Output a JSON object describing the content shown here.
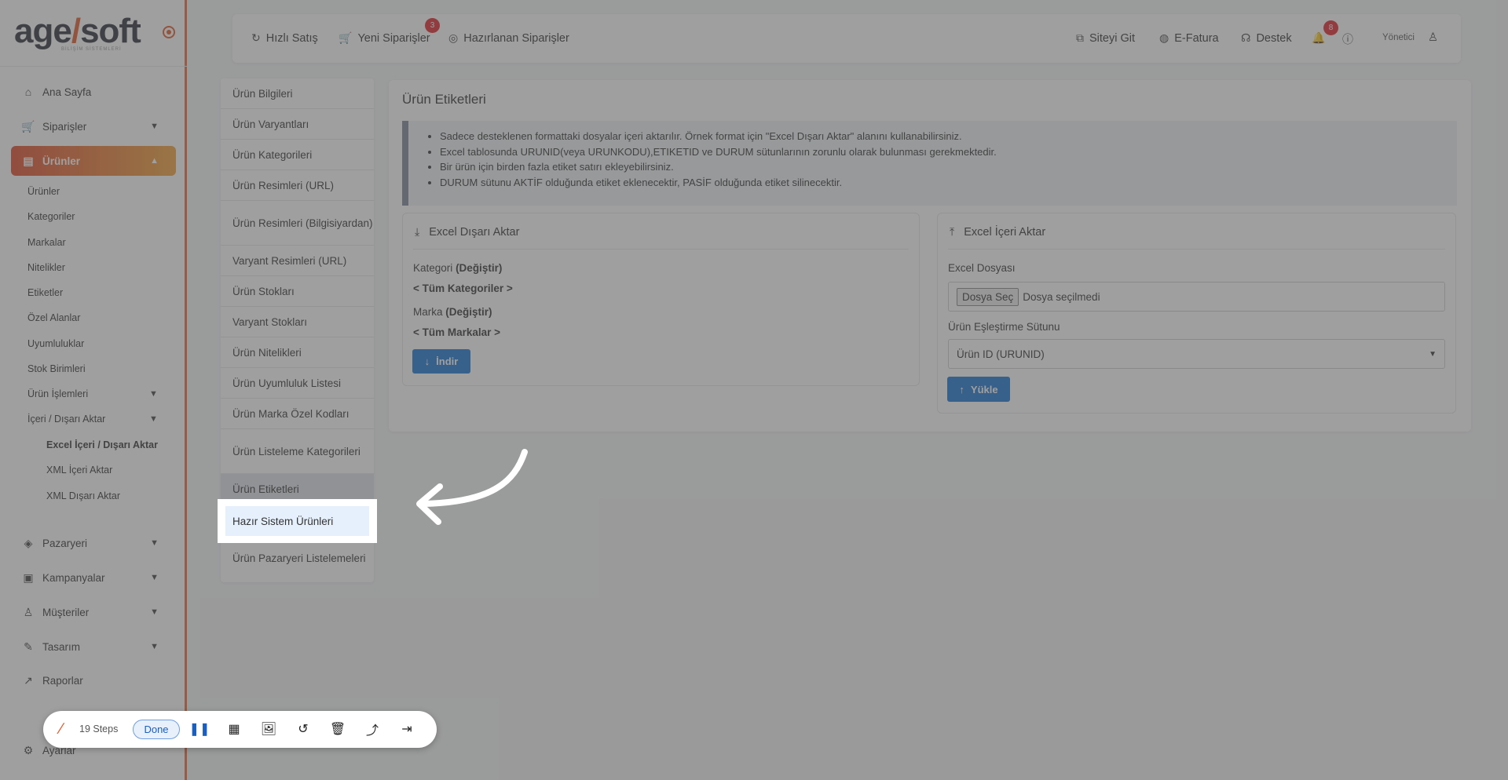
{
  "brand": {
    "logo_main": "age",
    "logo_slash": "/",
    "logo_tail": "soft",
    "logo_sub": "BİLİŞİM SİSTEMLERİ"
  },
  "sidebar": {
    "items": [
      {
        "label": "Ana Sayfa",
        "icon": "home-icon"
      },
      {
        "label": "Siparişler",
        "icon": "cart-icon"
      },
      {
        "label": "Ürünler",
        "icon": "book-icon"
      },
      {
        "label": "Pazaryeri",
        "icon": "box-icon"
      },
      {
        "label": "Kampanyalar",
        "icon": "gift-icon"
      },
      {
        "label": "Müşteriler",
        "icon": "user-icon"
      },
      {
        "label": "Tasarım",
        "icon": "brush-icon"
      },
      {
        "label": "Raporlar",
        "icon": "chart-icon"
      },
      {
        "label": "Ayarlar",
        "icon": "gear-icon"
      }
    ],
    "product_sub": [
      "Ürünler",
      "Kategoriler",
      "Markalar",
      "Nitelikler",
      "Etiketler",
      "Özel Alanlar",
      "Uyumluluklar",
      "Stok Birimleri",
      "Ürün İşlemleri",
      "İçeri / Dışarı Aktar"
    ],
    "import_sub": [
      "Excel İçeri / Dışarı Aktar",
      "XML İçeri Aktar",
      "XML Dışarı Aktar"
    ]
  },
  "topbar": {
    "links": [
      "Hızlı Satış",
      "Yeni Siparişler",
      "Hazırlanan Siparişler"
    ],
    "new_orders_badge": "3",
    "right_links": [
      "Siteyi Git",
      "E-Fatura",
      "Destek"
    ],
    "notif_badge": "8",
    "user": "Yönetici"
  },
  "menu": {
    "items": [
      "Ürün Bilgileri",
      "Ürün Varyantları",
      "Ürün Kategorileri",
      "Ürün Resimleri (URL)",
      "Ürün Resimleri (Bilgisiyardan)",
      "Varyant Resimleri (URL)",
      "Ürün Stokları",
      "Varyant Stokları",
      "Ürün Nitelikleri",
      "Ürün Uyumluluk Listesi",
      "Ürün Marka Özel Kodları",
      "Ürün Listeleme Kategorileri",
      "Ürün Etiketleri",
      "Hazır Sistem Ürünleri",
      "Ürün Pazaryeri Listelemeleri"
    ]
  },
  "main": {
    "title": "Ürün Etiketleri",
    "info": [
      "Sadece desteklenen formattaki dosyalar içeri aktarılır. Örnek format için \"Excel Dışarı Aktar\" alanını kullanabilirsiniz.",
      "Excel tablosunda URUNID(veya URUNKODU),ETIKETID ve DURUM sütunlarının zorunlu olarak bulunması gerekmektedir.",
      "Bir ürün için birden fazla etiket satırı ekleyebilirsiniz.",
      "DURUM sütunu AKTİF olduğunda etiket eklenecektir, PASİF olduğunda etiket silinecektir."
    ],
    "export": {
      "title": "Excel Dışarı Aktar",
      "category_label": "Kategori",
      "change": "(Değiştir)",
      "all_categories": "< Tüm Kategoriler >",
      "brand_label": "Marka",
      "all_brands": "< Tüm Markalar >",
      "download": "İndir"
    },
    "import": {
      "title": "Excel İçeri Aktar",
      "file_label": "Excel Dosyası",
      "file_button": "Dosya Seç",
      "file_none": "Dosya seçilmedi",
      "match_label": "Ürün Eşleştirme Sütunu",
      "match_value": "Ürün ID (URUNID)",
      "upload": "Yükle"
    }
  },
  "toolbar": {
    "steps": "19 Steps",
    "done": "Done"
  }
}
